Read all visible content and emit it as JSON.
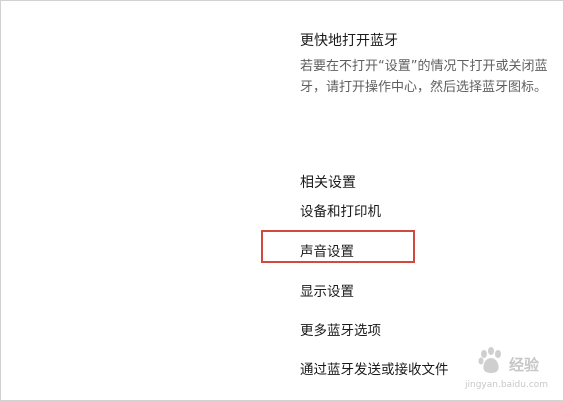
{
  "quick_bluetooth": {
    "title": "更快地打开蓝牙",
    "description": "若要在不打开“设置”的情况下打开或关闭蓝牙，请打开操作中心，然后选择蓝牙图标。"
  },
  "related_settings": {
    "title": "相关设置",
    "links": [
      {
        "label": "设备和打印机"
      },
      {
        "label": "声音设置"
      },
      {
        "label": "显示设置"
      },
      {
        "label": "更多蓝牙选项"
      },
      {
        "label": "通过蓝牙发送或接收文件"
      }
    ]
  },
  "watermark": {
    "text": "经验",
    "subtext": "jingyan.baidu.com"
  },
  "colors": {
    "highlight_border": "#d14a3f",
    "heading_text": "#1a1a1a",
    "description_text": "#5f5f5f"
  }
}
